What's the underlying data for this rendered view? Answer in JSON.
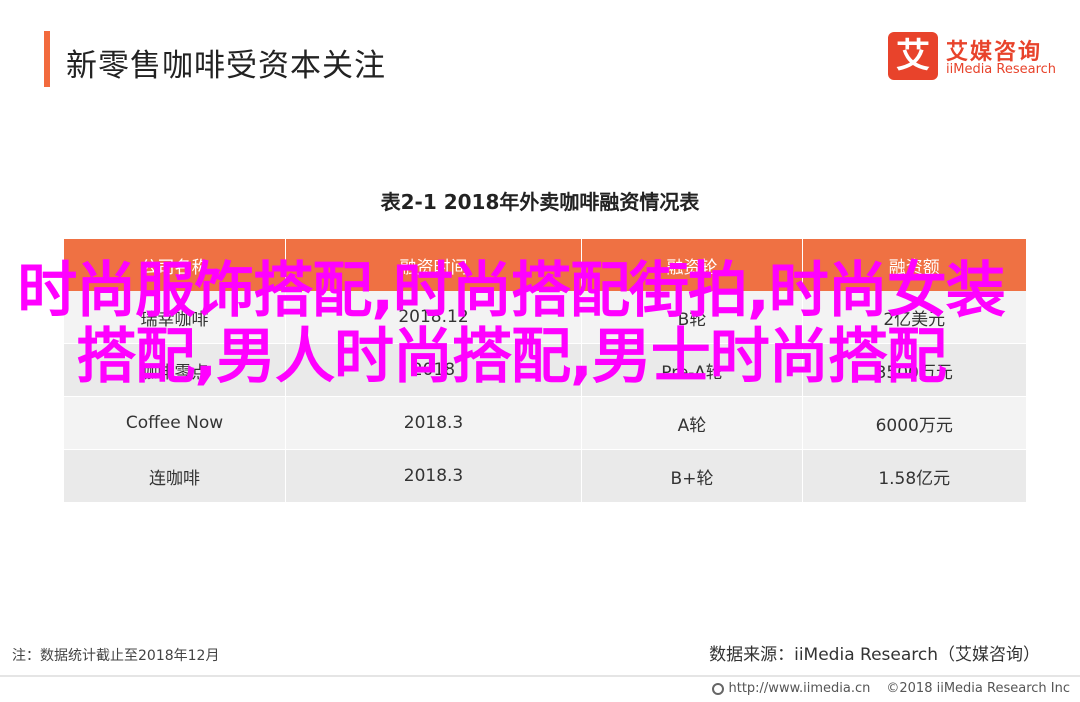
{
  "header": {
    "title": "新零售咖啡受资本关注"
  },
  "logo": {
    "mark": "艾",
    "name_cn": "艾媒咨询",
    "name_en": "iiMedia Research"
  },
  "table": {
    "title": "表2-1 2018年外卖咖啡融资情况表",
    "columns": [
      "公司名称",
      "融资时间",
      "融资轮",
      "融资额"
    ],
    "rows": [
      [
        "瑞幸咖啡",
        "2018.12",
        "B轮",
        "2亿美元"
      ],
      [
        "咖啡零点",
        "2018",
        "Pre-A轮",
        "3500万元"
      ],
      [
        "Coffee Now",
        "2018.3",
        "A轮",
        "6000万元"
      ],
      [
        "连咖啡",
        "2018.3",
        "B+轮",
        "1.58亿元"
      ]
    ]
  },
  "overlay": {
    "text": "时尚服饰搭配,时尚搭配街拍,时尚女装搭配,男人时尚搭配,男士时尚搭配"
  },
  "notes": {
    "left": "注：数据统计截止至2018年12月",
    "right": "数据来源：iiMedia Research（艾媒咨询）"
  },
  "footer": {
    "url": "http://www.iimedia.cn",
    "copyright": "©2018 iiMedia Research Inc"
  }
}
